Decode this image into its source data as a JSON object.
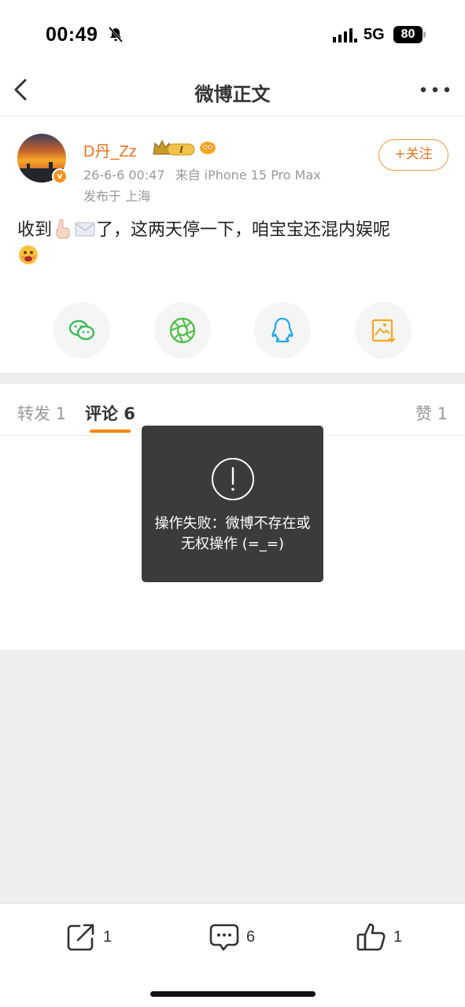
{
  "status_bar": {
    "time": "00:49",
    "network": "5G",
    "battery": "80"
  },
  "nav": {
    "title": "微博正文"
  },
  "post": {
    "username": "D丹_Zz",
    "timestamp": "26-6-6 00:47",
    "source": "来自 iPhone 15 Pro Max",
    "location": "发布于 上海",
    "follow_label": "+关注",
    "text_part1": "收到",
    "text_part2": "了，这两天停一下，咱宝宝还混内娱呢"
  },
  "share_icons": [
    "wechat-icon",
    "moments-icon",
    "qq-icon",
    "save-image-icon"
  ],
  "tabs": {
    "repost": "转发 1",
    "comments": "评论 6",
    "likes": "赞 1"
  },
  "toast": {
    "message": "操作失败：微博不存在或无权操作 (=_=)"
  },
  "toolbar": {
    "repost_count": "1",
    "comment_count": "6",
    "like_count": "1"
  },
  "colors": {
    "accent": "#ff8200",
    "username": "#e8731c",
    "toast_bg": "#333333"
  }
}
